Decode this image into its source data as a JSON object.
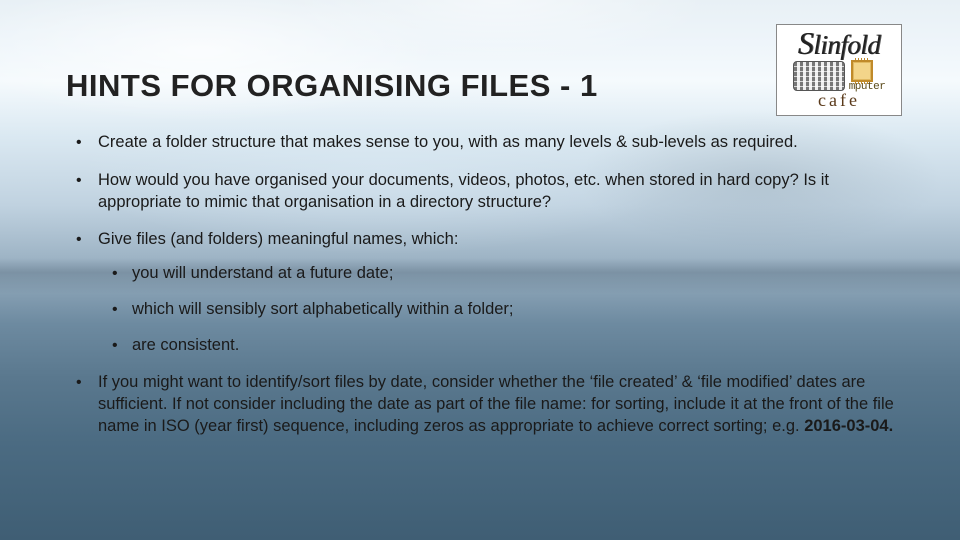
{
  "title": "HINTS FOR ORGANISING FILES - 1",
  "logo": {
    "brand": "Slinfold",
    "brand_cap": "S",
    "brand_rest": "linfold",
    "word_computer": "mputer",
    "word_c": "c",
    "cafe": "cafe"
  },
  "bullets": {
    "b1": "Create a folder structure that makes sense to you, with as many levels & sub-levels as required.",
    "b2": "How would you have organised your documents, videos, photos, etc. when stored in hard copy?  Is it appropriate to mimic that organisation in a directory structure?",
    "b3": {
      "lead": "Give files (and folders) meaningful names, which:",
      "s1": "you will understand at a future date;",
      "s2": "which will sensibly sort alphabetically within a folder;",
      "s3": "are consistent."
    },
    "b4": {
      "text_before": "If you might want to identify/sort files by date, consider whether the ‘file created’ & ‘file modified’ dates are sufficient.  If not consider including the date as part of the file name: for sorting, include it at the front of the file name in ISO (year first) sequence, including zeros as appropriate to achieve correct sorting; e.g. ",
      "example": "2016-03-04.",
      "text_after": ""
    }
  }
}
